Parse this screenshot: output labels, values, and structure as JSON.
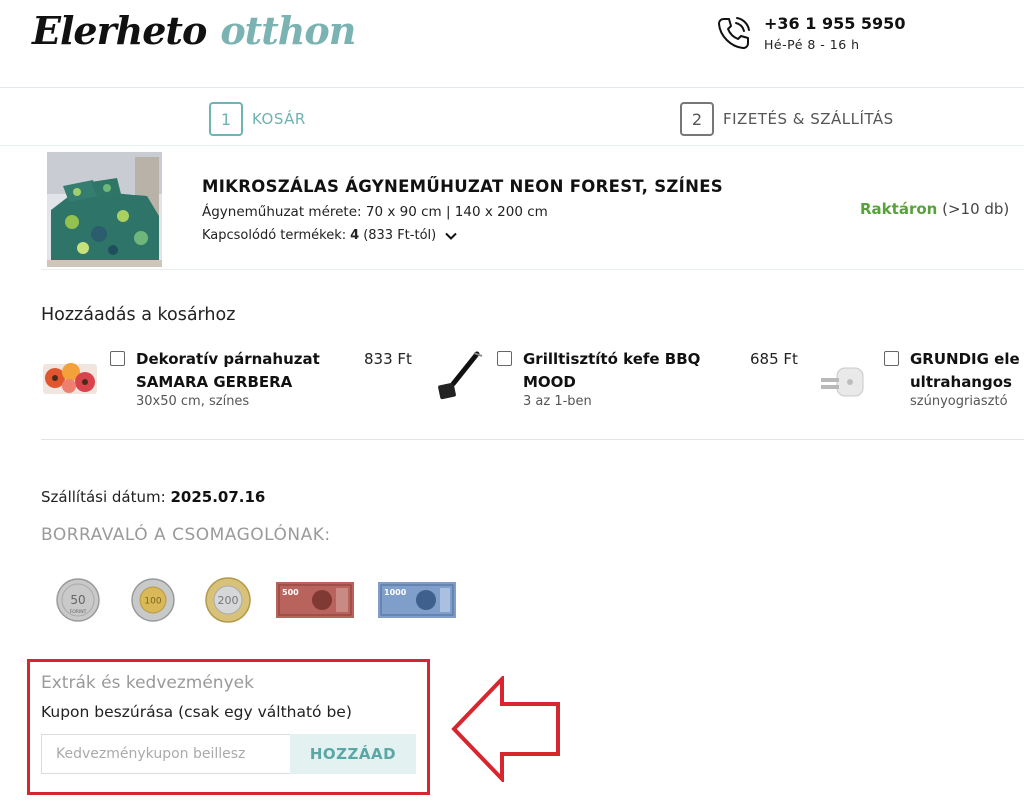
{
  "header": {
    "logo_part1": "Elerheto",
    "logo_part2": "otthon",
    "phone": "+36 1 955 5950",
    "hours": "Hé-Pé 8 - 16 h"
  },
  "steps": [
    {
      "num": "1",
      "label": "KOSÁR"
    },
    {
      "num": "2",
      "label": "FIZETÉS & SZÁLLÍTÁS"
    }
  ],
  "product": {
    "title": "MIKROSZÁLAS ÁGYNEMŰHUZAT NEON FOREST, SZÍNES",
    "size": "Ágyneműhuzat mérete: 70 x 90 cm | 140 x 200 cm",
    "related_label": "Kapcsolódó termékek:",
    "related_count": "4",
    "related_from": "(833 Ft-tól)",
    "stock_status": "Raktáron",
    "stock_count": "(>10 db)"
  },
  "addons": {
    "heading": "Hozzáadás a kosárhoz",
    "items": [
      {
        "name1": "Dekoratív párnahuzat",
        "name2": "SAMARA GERBERA",
        "sub": "30x50 cm, színes",
        "price": "833 Ft"
      },
      {
        "name1": "Grilltisztító kefe BBQ",
        "name2": "MOOD",
        "sub": "3 az 1-ben",
        "price": "685 Ft"
      },
      {
        "name1": "GRUNDIG ele",
        "name2": "ultrahangos",
        "sub": "szúnyogriasztó",
        "price": ""
      }
    ]
  },
  "shipping": {
    "label": "Szállítási dátum:",
    "date": "2025.07.16"
  },
  "tip": {
    "heading": "BORRAVALÓ A CSOMAGOLÓNAK:",
    "coin_50_text": "50",
    "coin_50_sub": "FORINT",
    "coin_100_text": "100",
    "coin_200_text": "200",
    "note_500": "500",
    "note_1000": "1000"
  },
  "extras": {
    "title": "Extrák és kedvezmények",
    "subtitle": "Kupon beszúrása (csak egy váltható be)",
    "placeholder": "Kedvezménykupon beillesz",
    "button": "HOZZÁAD"
  },
  "colors": {
    "accent": "#6fb3b2",
    "highlight": "#d8262f",
    "stock": "#57a23b"
  }
}
